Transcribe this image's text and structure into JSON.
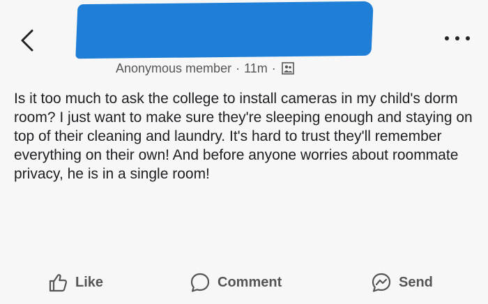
{
  "post": {
    "author": "Anonymous member",
    "time": "11m",
    "separator": "·",
    "body": "Is it too much to ask the college to install cameras in my child's dorm room? I just want to make sure they're sleeping enough and staying on top of their cleaning and laundry. It's hard to trust they'll remember everything on their own! And before anyone worries about roommate privacy, he is in a single room!"
  },
  "actions": {
    "like": "Like",
    "comment": "Comment",
    "send": "Send"
  },
  "icons": {
    "back": "chevron-left-icon",
    "more": "more-dots-icon",
    "group": "group-icon",
    "like": "thumbs-up-icon",
    "comment": "speech-bubble-icon",
    "send": "messenger-icon"
  },
  "colors": {
    "redaction": "#1f7fd6",
    "text": "#1c1e21",
    "muted": "#555555"
  }
}
